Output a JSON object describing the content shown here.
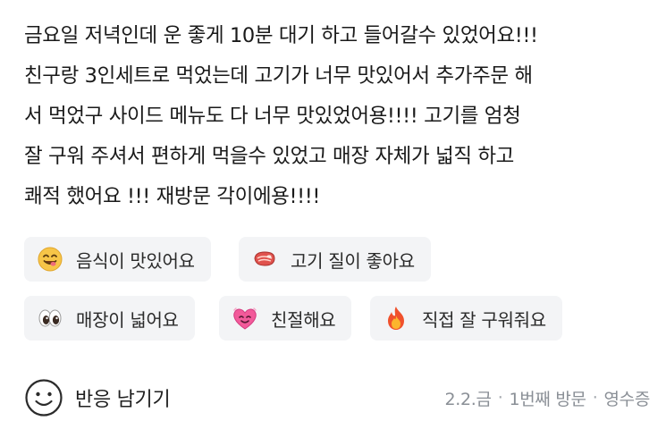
{
  "review": {
    "text": "금요일 저녁인데 운 좋게 10분 대기 하고 들어갈수 있었어요!!!\n친구랑 3인세트로 먹었는데 고기가 너무 맛있어서 추가주문 해\n서 먹었구 사이드 메뉴도 다 너무 맛있었어용!!!! 고기를 엄청\n잘 구워 주셔서 편하게 먹을수 있었고 매장 자체가 넓직 하고\n쾌적 했어요 !!! 재방문 각이에용!!!!"
  },
  "tags": [
    {
      "label": "음식이 맛있어요",
      "icon": "yummy-face-icon"
    },
    {
      "label": "고기 질이 좋아요",
      "icon": "steak-icon"
    },
    {
      "label": "매장이 넓어요",
      "icon": "eyes-icon"
    },
    {
      "label": "친절해요",
      "icon": "heart-face-icon"
    },
    {
      "label": "직접 잘 구워줘요",
      "icon": "fire-icon"
    }
  ],
  "reaction": {
    "label": "반응 남기기",
    "icon": "smile-outline-icon"
  },
  "meta": {
    "date": "2.2.금",
    "visit": "1번째 방문",
    "receipt": "영수증"
  }
}
